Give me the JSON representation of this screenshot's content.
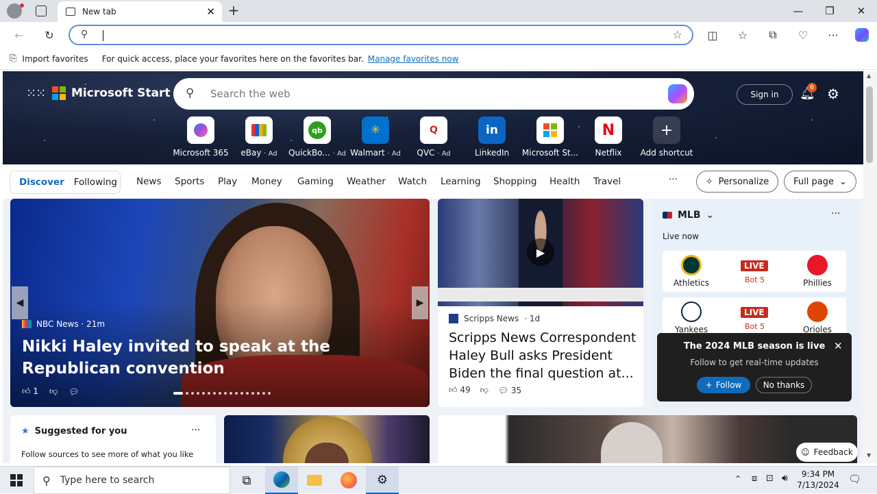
{
  "browser": {
    "tab_title": "New tab",
    "favbar": {
      "import_label": "Import favorites",
      "hint": "For quick access, place your favorites here on the favorites bar.",
      "manage_link": "Manage favorites now"
    }
  },
  "page": {
    "brand": "Microsoft Start",
    "search_placeholder": "Search the web",
    "sign_in": "Sign in",
    "notification_count": "6",
    "shortcuts": [
      {
        "label": "Microsoft 365",
        "ad": ""
      },
      {
        "label": "eBay",
        "ad": "· Ad"
      },
      {
        "label": "QuickBo...",
        "ad": "· Ad"
      },
      {
        "label": "Walmart",
        "ad": "· Ad"
      },
      {
        "label": "QVC",
        "ad": "· Ad"
      },
      {
        "label": "LinkedIn",
        "ad": ""
      },
      {
        "label": "Microsoft St...",
        "ad": ""
      },
      {
        "label": "Netflix",
        "ad": ""
      },
      {
        "label": "Add shortcut",
        "ad": ""
      }
    ],
    "nav": {
      "discover": "Discover",
      "following": "Following",
      "items": [
        "News",
        "Sports",
        "Play",
        "Money",
        "Gaming",
        "Weather",
        "Watch",
        "Learning",
        "Shopping",
        "Health",
        "Travel"
      ],
      "more": "···",
      "personalize": "Personalize",
      "fullpage": "Full page"
    },
    "big_card": {
      "source": "NBC News · 21m",
      "title": "Nikki Haley invited to speak at the Republican convention",
      "likes": "1"
    },
    "mid_card": {
      "source": "Scripps News",
      "age": "· 1d",
      "title": "Scripps News Correspondent Haley Bull asks President Biden the final question at...",
      "likes": "49",
      "comments": "35"
    },
    "mlb": {
      "title": "MLB",
      "live_now": "Live now",
      "games": [
        {
          "home": "Athletics",
          "away": "Phillies",
          "status": "LIVE",
          "inning": "Bot 5"
        },
        {
          "home": "Yankees",
          "away": "Orioles",
          "status": "LIVE",
          "inning": "Bot 5"
        }
      ],
      "popup": {
        "title": "The 2024 MLB season is live",
        "subtitle": "Follow to get real-time updates",
        "follow": "Follow",
        "no_thanks": "No thanks"
      }
    },
    "suggested": {
      "title": "Suggested for you",
      "text": "Follow sources to see more of what you like"
    },
    "feedback": "Feedback"
  },
  "taskbar": {
    "search_placeholder": "Type here to search",
    "time": "9:34 PM",
    "date": "7/13/2024"
  },
  "colors": {
    "accent": "#0f6cbd",
    "live": "#c42b1c",
    "hero_bg": "#162038"
  }
}
